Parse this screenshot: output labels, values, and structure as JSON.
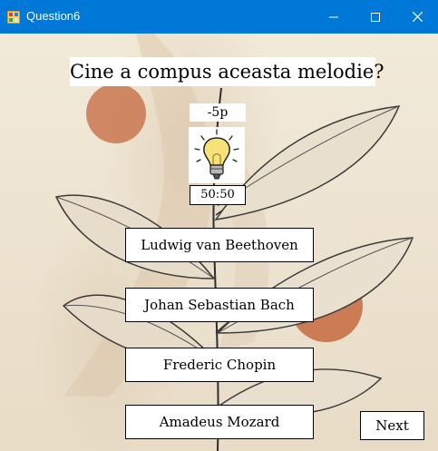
{
  "window": {
    "title": "Question6",
    "icons": {
      "app": "app-icon",
      "minimize": "minimize-icon",
      "maximize": "maximize-icon",
      "close": "close-icon"
    },
    "colors": {
      "titlebar": "#0078d7"
    }
  },
  "quiz": {
    "question": "Cine a compus aceasta melodie?",
    "penalty": "-5p",
    "hint_icon": "lightbulb-icon",
    "fifty_fifty": "50:50",
    "answers": [
      "Ludwig van Beethoven",
      "Johan Sebastian Bach",
      "Frederic Chopin",
      "Amadeus Mozard"
    ],
    "next_label": "Next"
  }
}
